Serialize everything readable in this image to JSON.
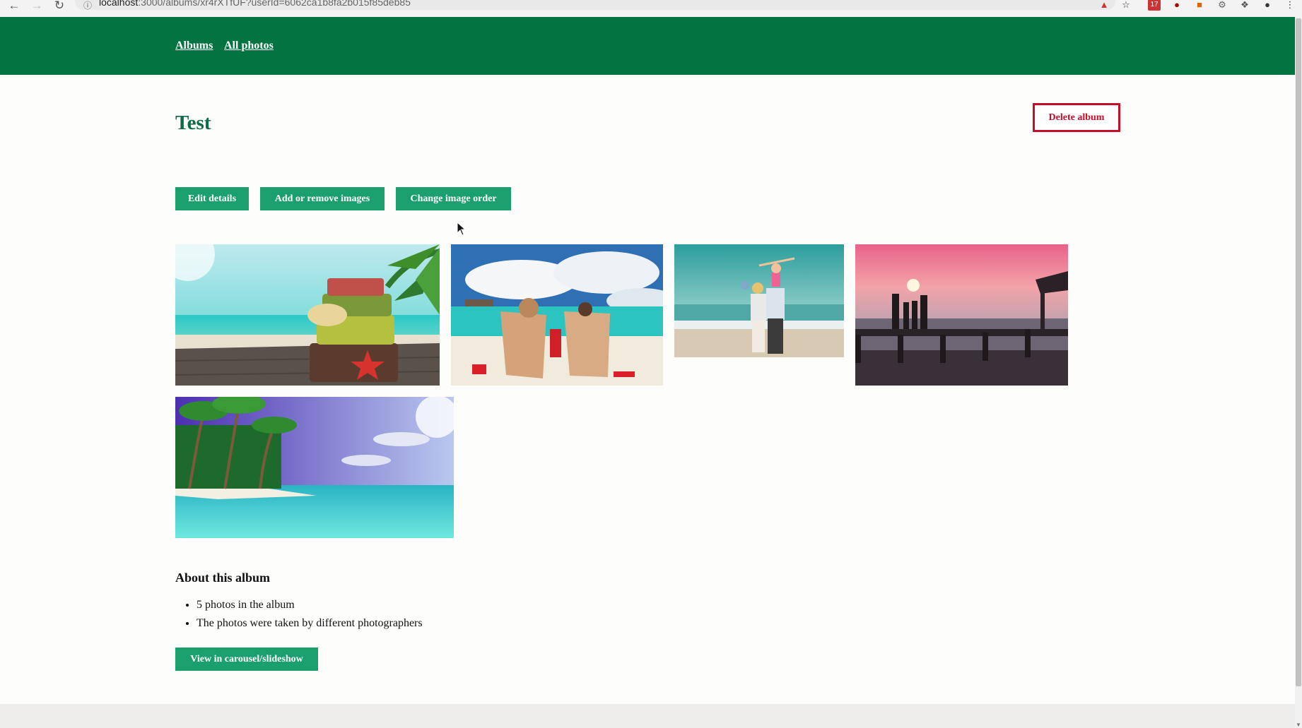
{
  "browser": {
    "url_host": "localhost",
    "url_rest": ":3000/albums/xr4rXTfUF?userId=6062ca1b8fa2b015f85deb85",
    "badge_count": "17"
  },
  "nav": {
    "albums_label": "Albums",
    "all_photos_label": "All photos"
  },
  "album": {
    "title": "Test",
    "delete_label": "Delete album",
    "edit_label": "Edit details",
    "add_remove_label": "Add or remove images",
    "change_order_label": "Change image order"
  },
  "photos": [
    {
      "name": "beach-suitcases-palm"
    },
    {
      "name": "beach-deckchairs-couple"
    },
    {
      "name": "family-beach-child-shoulders"
    },
    {
      "name": "sunset-pier-family"
    },
    {
      "name": "tropical-island-palms"
    }
  ],
  "about": {
    "heading": "About this album",
    "facts": [
      "5 photos in the album",
      "The photos were taken by different photographers"
    ],
    "slideshow_label": "View in carousel/slideshow"
  },
  "colors": {
    "header_green": "#037342",
    "button_green": "#1a9f6d",
    "title_green": "#0d6b45",
    "danger_red": "#c50f2a"
  }
}
